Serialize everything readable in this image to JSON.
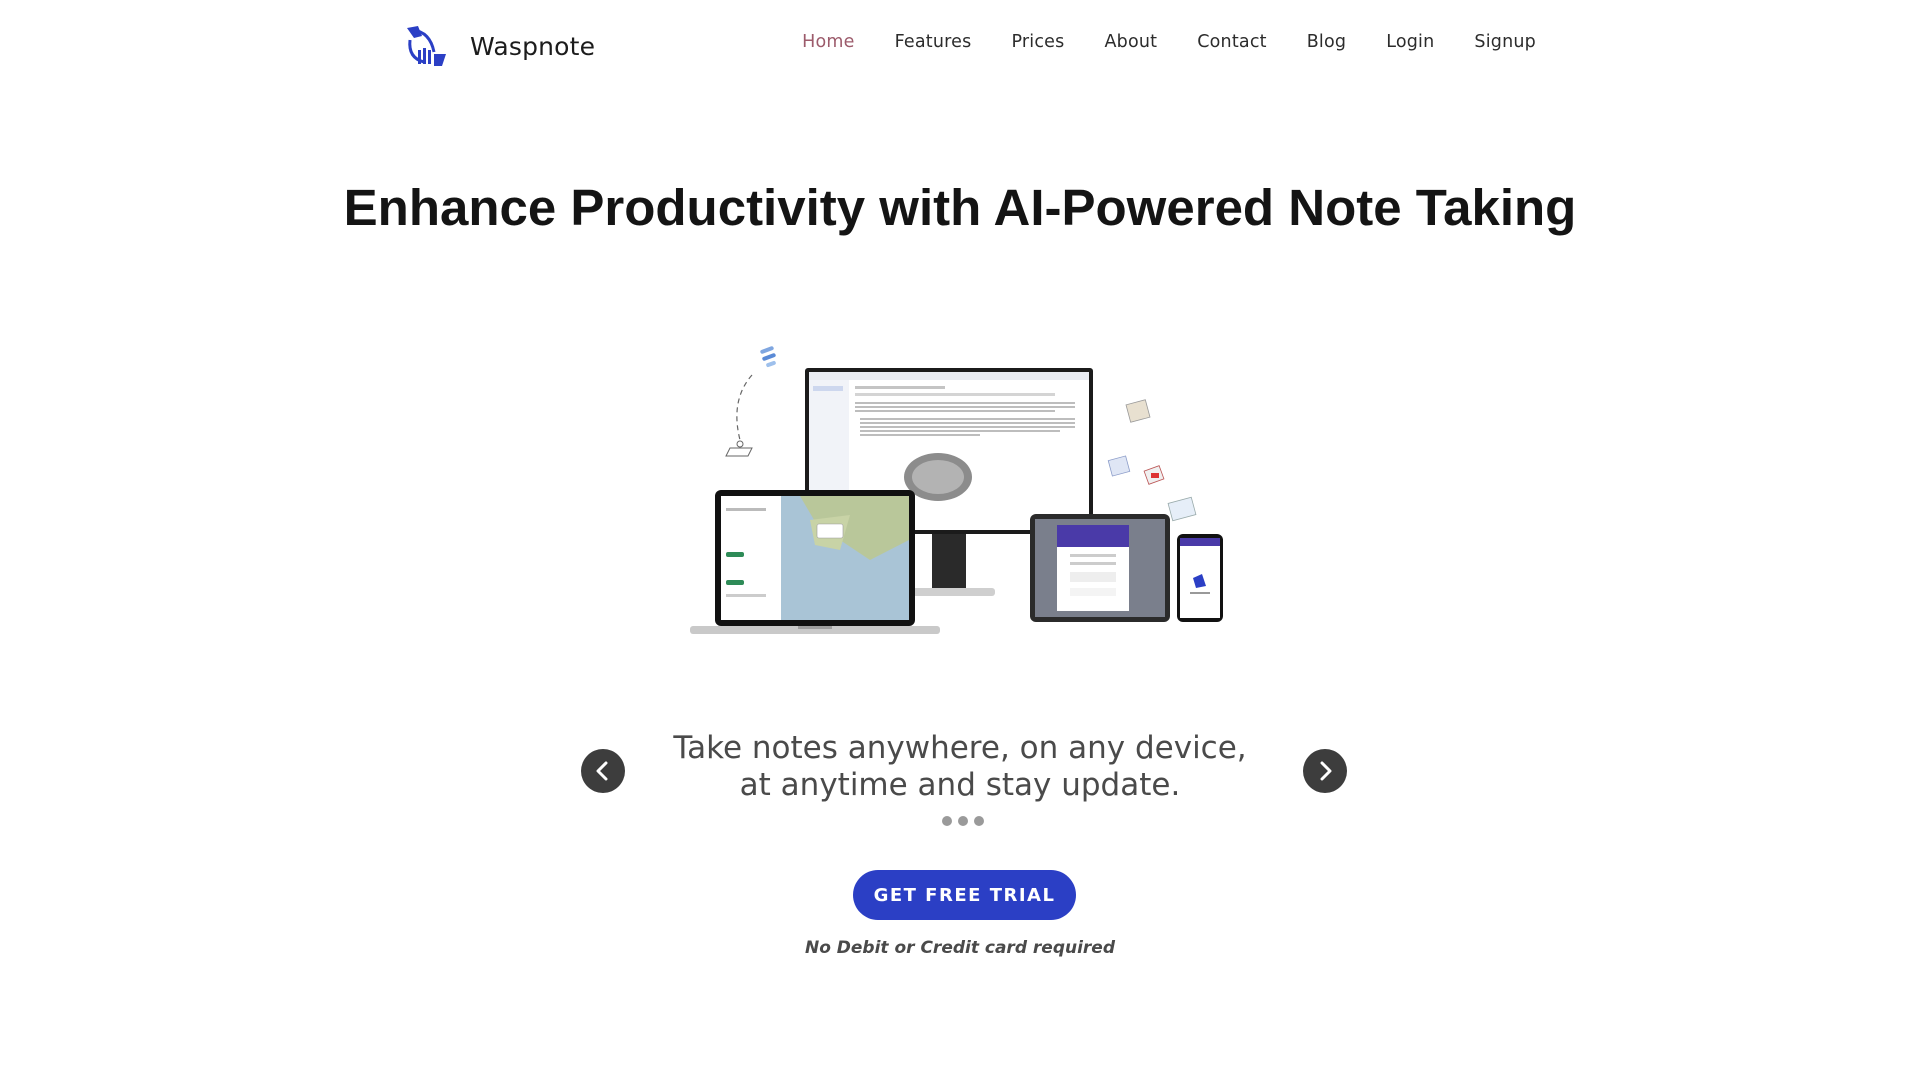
{
  "brand": {
    "name": "Waspnote",
    "color": "#2b3fc5"
  },
  "nav": {
    "items": [
      {
        "label": "Home",
        "active": true
      },
      {
        "label": "Features",
        "active": false
      },
      {
        "label": "Prices",
        "active": false
      },
      {
        "label": "About",
        "active": false
      },
      {
        "label": "Contact",
        "active": false
      },
      {
        "label": "Blog",
        "active": false
      },
      {
        "label": "Login",
        "active": false
      },
      {
        "label": "Signup",
        "active": false
      }
    ],
    "active_color": "#9c5b6b"
  },
  "hero": {
    "title": "Enhance Productivity with AI-Powered Note Taking"
  },
  "carousel": {
    "slide_text": "Take notes anywhere, on any device, at anytime and stay update.",
    "slide_count": 3,
    "prev_icon": "chevron-left-icon",
    "next_icon": "chevron-right-icon"
  },
  "cta": {
    "label": "GET FREE TRIAL",
    "note": "No Debit or Credit card required",
    "color": "#2b3fc5"
  }
}
